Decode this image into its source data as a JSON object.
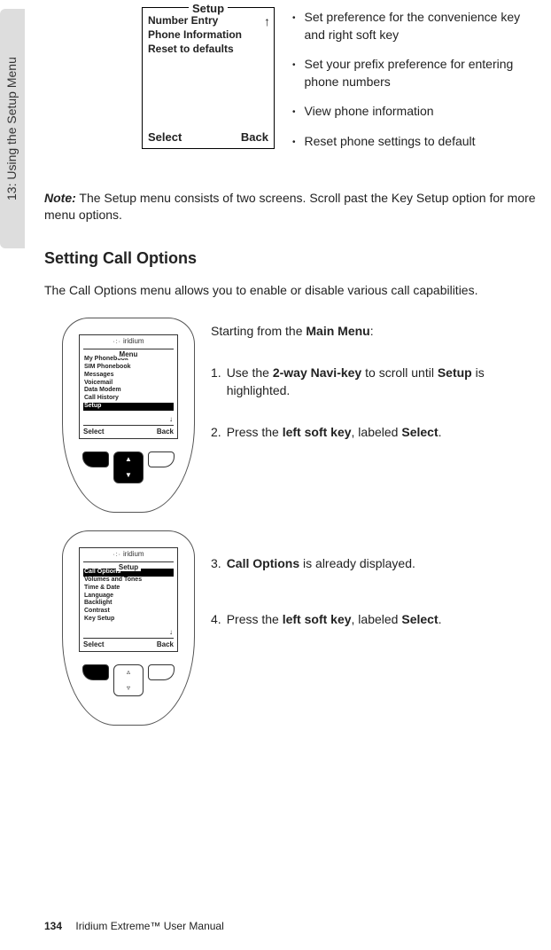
{
  "sideTab": "13: Using the Setup Menu",
  "topBox": {
    "title": "Setup",
    "items": [
      "Number Entry",
      "Phone Information",
      "Reset to defaults"
    ],
    "arrow": "↑",
    "softLeft": "Select",
    "softRight": "Back"
  },
  "bullets": [
    "Set preference for the convenience key and right soft key",
    "Set your prefix preference for entering phone numbers",
    "View phone information",
    "Reset phone settings to default"
  ],
  "note": {
    "label": "Note:",
    "text": " The Setup menu consists of two screens. Scroll past the Key Setup option for more menu options."
  },
  "sectionTitle": "Setting Call Options",
  "sectionIntro": "The Call Options menu allows you to enable or disable various call capabilities.",
  "phone1": {
    "brand": "iridium",
    "screenTitle": "Menu",
    "items": [
      "My Phonebook",
      "SIM Phonebook",
      "Messages",
      "Voicemail",
      "Data Modem",
      "Call History",
      "Setup"
    ],
    "hlIndex": 6,
    "arrow": "↓",
    "softLeft": "Select",
    "softRight": "Back"
  },
  "phone2": {
    "brand": "iridium",
    "screenTitle": "Setup",
    "items": [
      "Call Options",
      "Volumes and Tones",
      "Time & Date",
      "Language",
      "Backlight",
      "Contrast",
      "Key Setup"
    ],
    "hlIndex": 0,
    "arrow": "↓",
    "softLeft": "Select",
    "softRight": "Back"
  },
  "steps1": {
    "intro_a": "Starting from the ",
    "intro_b": "Main Menu",
    "intro_c": ":",
    "s1a": "1.",
    "s1b": "Use the ",
    "s1c": "2-way Navi-key",
    "s1d": " to scroll until ",
    "s1e": "Setup",
    "s1f": " is highlighted.",
    "s2a": "2.",
    "s2b": "Press the ",
    "s2c": "left soft key",
    "s2d": ", labeled ",
    "s2e": "Select",
    "s2f": "."
  },
  "steps2": {
    "s3a": "3.",
    "s3b": "Call Options",
    "s3c": " is already displayed.",
    "s4a": "4.",
    "s4b": "Press the ",
    "s4c": "left soft key",
    "s4d": ", labeled ",
    "s4e": "Select",
    "s4f": "."
  },
  "footer": {
    "page": "134",
    "title": "Iridium Extreme™ User Manual"
  }
}
